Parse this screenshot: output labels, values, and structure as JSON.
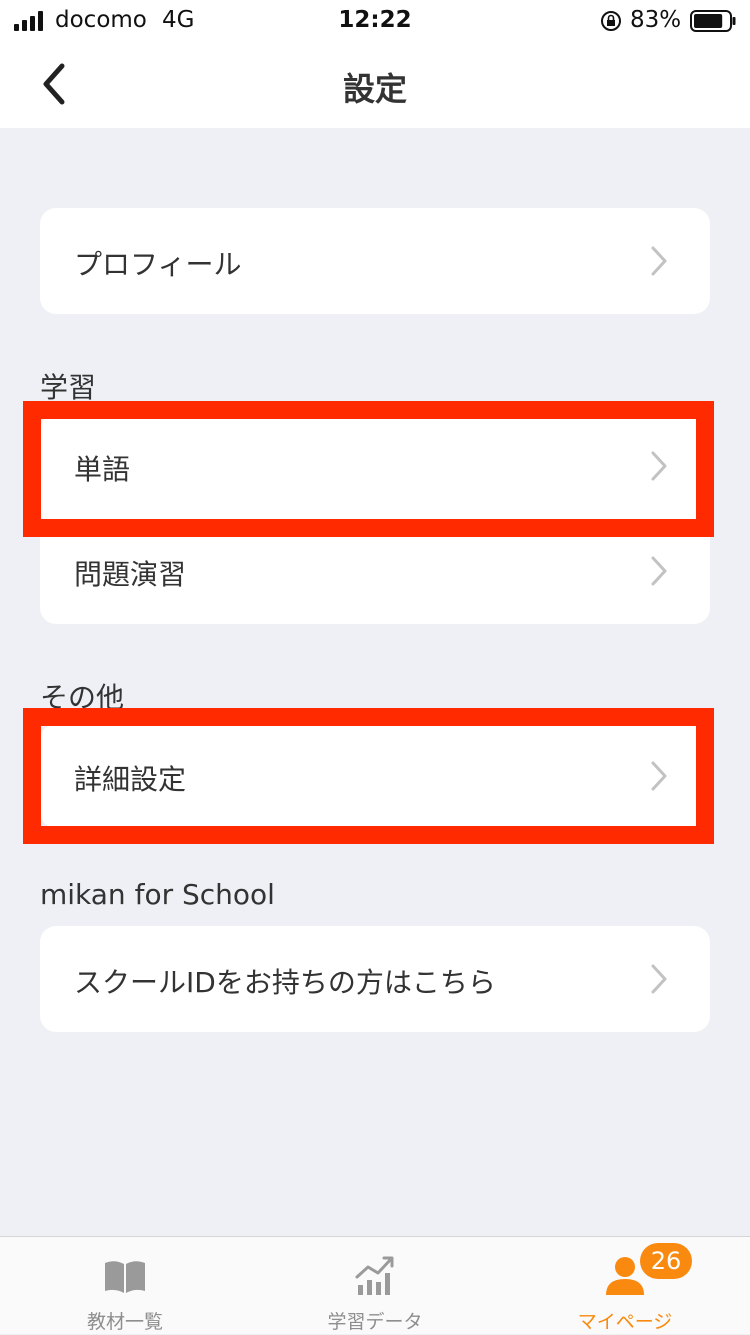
{
  "status_bar": {
    "carrier": "docomo",
    "network": "4G",
    "time": "12:22",
    "battery": "83%",
    "battery_level": 0.83
  },
  "nav": {
    "title": "設定",
    "back_icon": "chevron-left-icon"
  },
  "profile": {
    "label": "プロフィール"
  },
  "sections": {
    "study": {
      "header": "学習",
      "items": [
        {
          "label": "単語"
        },
        {
          "label": "問題演習"
        }
      ]
    },
    "other": {
      "header": "その他",
      "items": [
        {
          "label": "詳細設定"
        }
      ]
    },
    "school": {
      "header": "mikan for School",
      "items": [
        {
          "label": "スクールIDをお持ちの方はこちら"
        }
      ]
    }
  },
  "tab_bar": {
    "tabs": [
      {
        "label": "教材一覧",
        "icon": "book-icon"
      },
      {
        "label": "学習データ",
        "icon": "chart-icon"
      },
      {
        "label": "マイページ",
        "icon": "person-icon",
        "active": true
      }
    ],
    "badge": "26"
  },
  "colors": {
    "accent": "#f98a0f",
    "highlight": "#ff2a00",
    "background": "#eef0f5"
  }
}
